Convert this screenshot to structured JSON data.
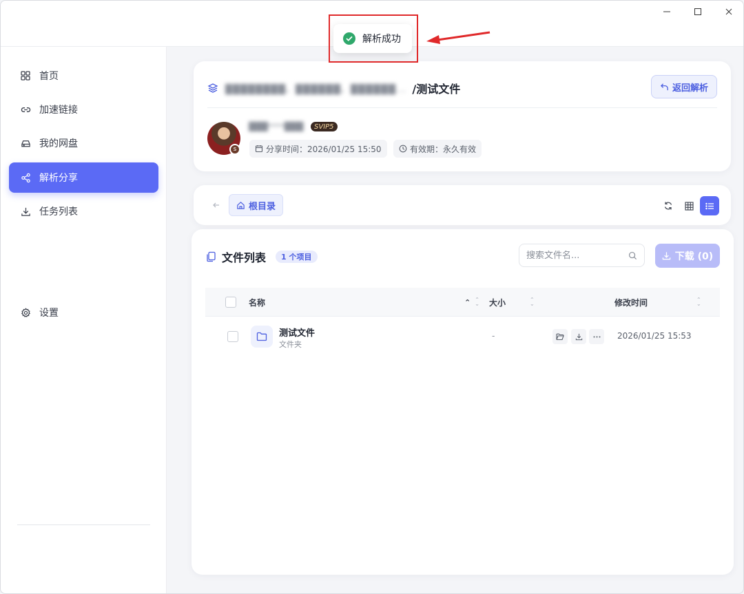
{
  "toast": {
    "message": "解析成功"
  },
  "sidebar": {
    "items": [
      {
        "label": "首页",
        "icon": "grid-icon"
      },
      {
        "label": "加速链接",
        "icon": "link-icon"
      },
      {
        "label": "我的网盘",
        "icon": "drive-icon"
      },
      {
        "label": "解析分享",
        "icon": "share-icon",
        "active": true
      },
      {
        "label": "任务列表",
        "icon": "download-icon"
      },
      {
        "label": "设置",
        "icon": "gear-icon"
      }
    ]
  },
  "share": {
    "path_blurred": "████████、██████、██████...",
    "folder": "/测试文件",
    "back_label": "返回解析",
    "username_blurred": "███****███",
    "vip_badge": "SVIP5",
    "share_time": "分享时间：2026/01/25 15:50",
    "validity": "有效期：永久有效"
  },
  "navigation": {
    "root_label": "根目录"
  },
  "file_list": {
    "title": "文件列表",
    "count_badge": "1 个项目",
    "search_placeholder": "搜索文件名...",
    "download_label": "下载 (0)",
    "columns": {
      "name": "名称",
      "size": "大小",
      "modified": "修改时间"
    },
    "rows": [
      {
        "name": "测试文件",
        "type": "文件夹",
        "size": "-",
        "modified": "2026/01/25 15:53"
      }
    ]
  },
  "colors": {
    "accent": "#5b6af5",
    "success": "#2fa86b",
    "annotation": "#e0292a"
  }
}
